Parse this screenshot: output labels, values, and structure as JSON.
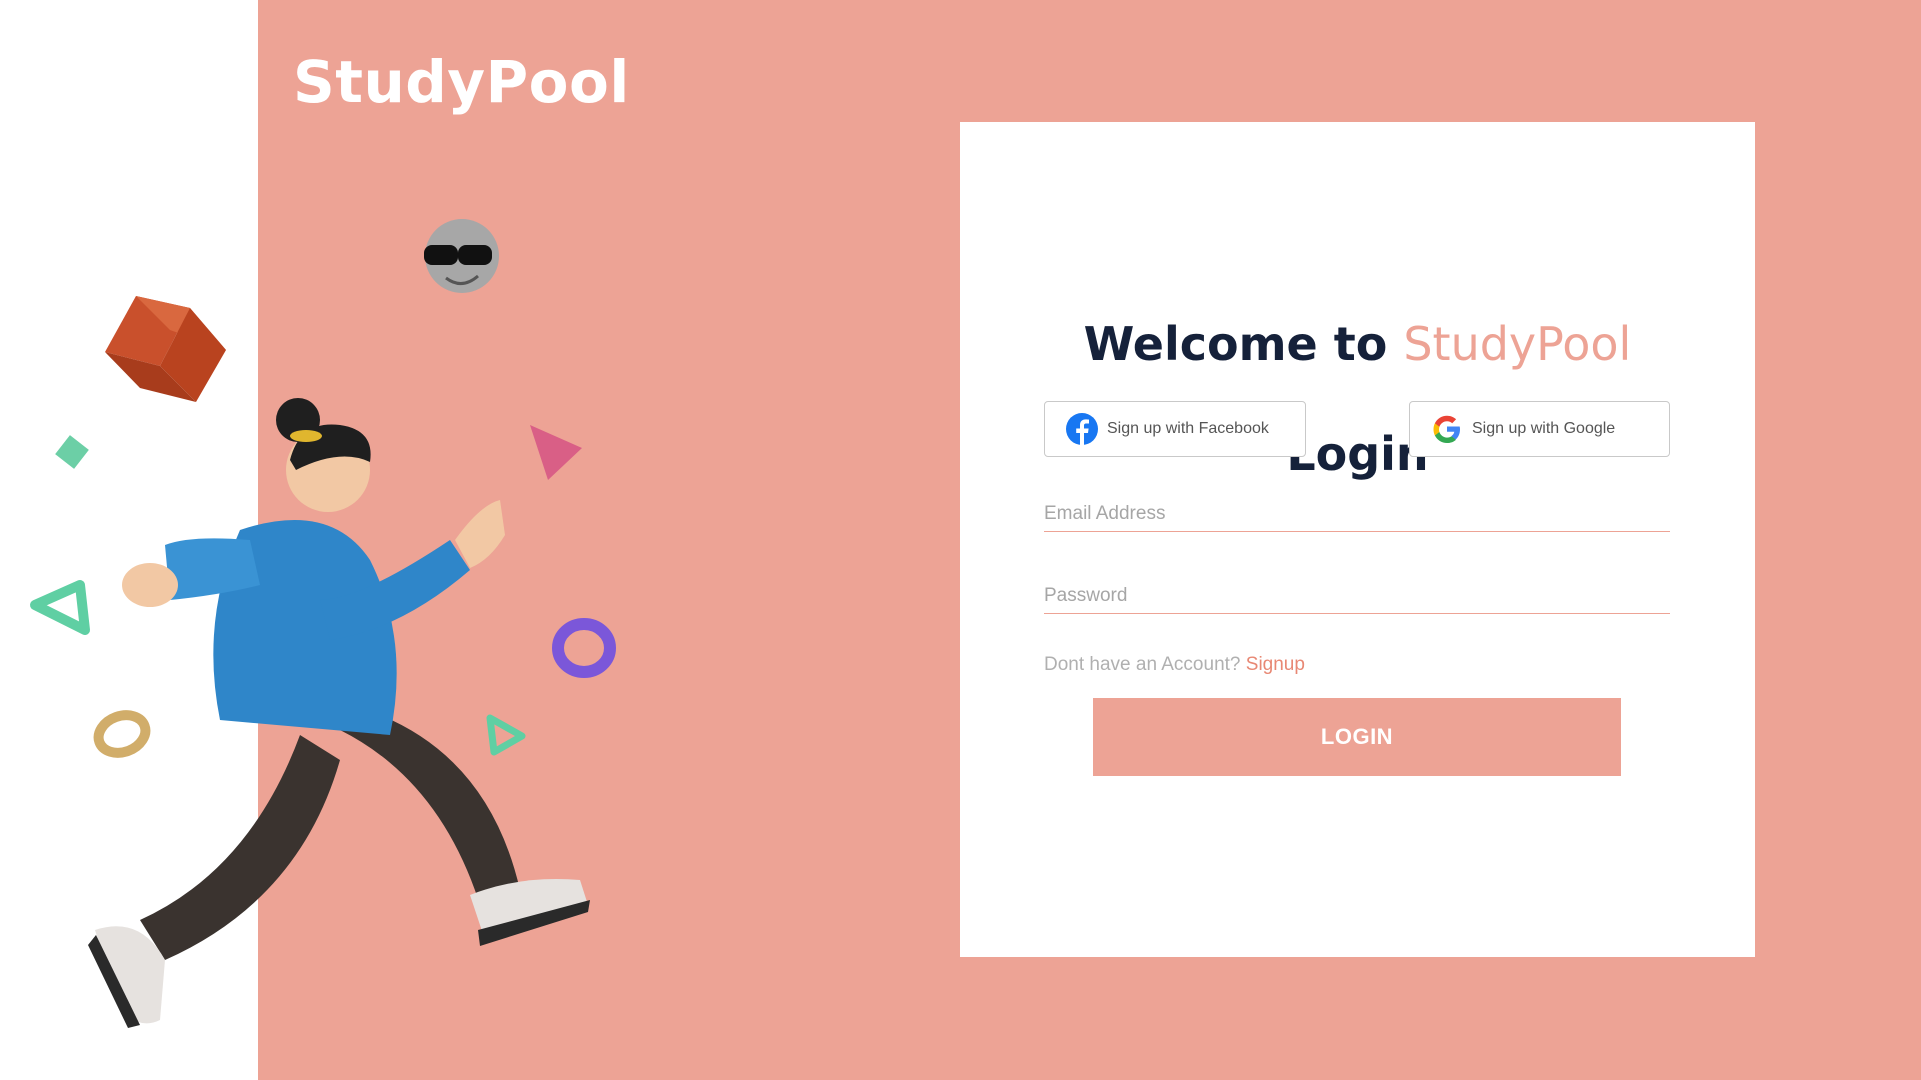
{
  "brand": {
    "name": "StudyPool"
  },
  "card": {
    "welcome_prefix": "Welcome to",
    "welcome_brand": "StudyPool",
    "title": "Login",
    "facebook_label": "Sign up with Facebook",
    "google_label": "Sign up with Google",
    "email_placeholder": "Email Address",
    "password_placeholder": "Password",
    "signup_prompt": "Dont have an Account?",
    "signup_link": "Signup",
    "login_button": "LOGIN"
  },
  "colors": {
    "accent": "#eda395",
    "heading": "#15213a",
    "background": "#ffffff"
  },
  "icons": [
    "facebook-icon",
    "google-icon"
  ]
}
